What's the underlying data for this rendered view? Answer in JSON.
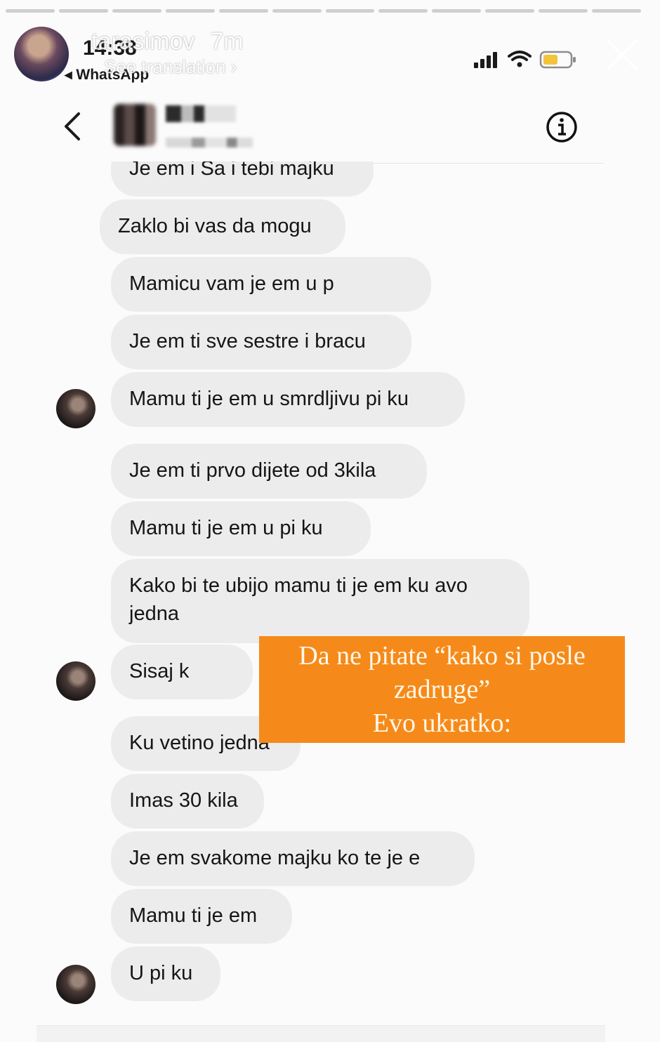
{
  "story": {
    "username": "tarasimov",
    "time": "7m",
    "see_translation": "See translation ›",
    "segments": 12
  },
  "status_bar": {
    "clock": "14:38",
    "back_app": "◂ WhatsApp"
  },
  "chat": {
    "messages": [
      {
        "text": "Je  em i Sa i tebi majku"
      },
      {
        "text": "Zaklo bi vas da mogu"
      },
      {
        "text": "Mamicu vam je  em u p"
      },
      {
        "text": "Je  em ti sve sestre i bracu"
      },
      {
        "text": "Mamu ti je  em u smrdljivu pi  ku"
      },
      {
        "text": "Je  em ti prvo dijete od 3kila"
      },
      {
        "text": "Mamu ti je  em u pi  ku"
      },
      {
        "text": "Kako bi te ubijo mamu ti je  em ku  avo jedna"
      },
      {
        "text": "Sisaj k"
      },
      {
        "text": "Ku  vetino jedna"
      },
      {
        "text": "Imas 30 kila"
      },
      {
        "text": "Je  em svakome majku ko te je  e"
      },
      {
        "text": "Mamu ti je  em"
      },
      {
        "text": "U pi  ku"
      }
    ]
  },
  "overlay": {
    "line1": "Da ne pitate “kako si posle",
    "line2": "zadruge”",
    "line3": "Evo ukratko:",
    "background": "#f58a1a"
  },
  "icons": {
    "close": "close-icon",
    "back": "chevron-left-icon",
    "info": "info-icon"
  }
}
